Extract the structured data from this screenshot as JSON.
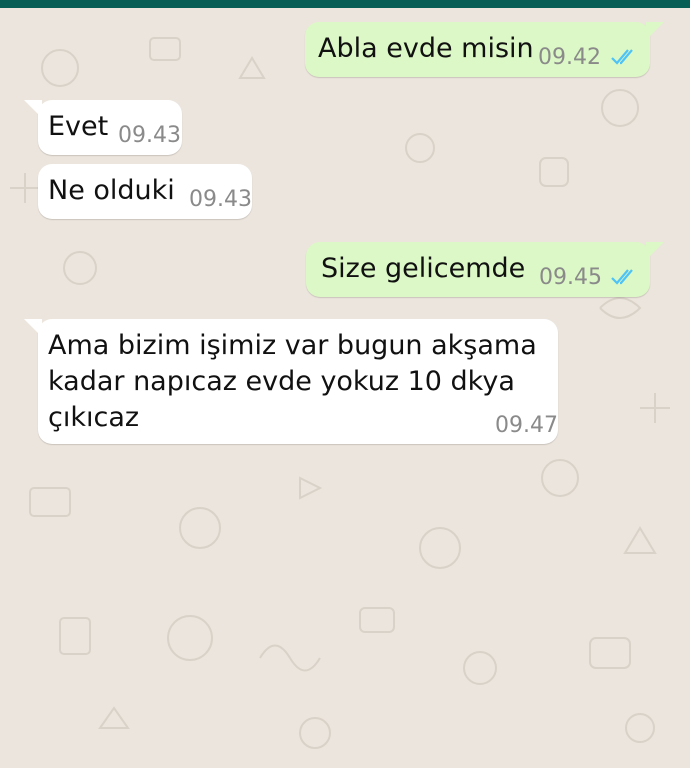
{
  "colors": {
    "header": "#075e54",
    "outgoing_bubble": "#dcf8c6",
    "incoming_bubble": "#ffffff",
    "read_ticks": "#4fc3f7",
    "wallpaper": "#ece5dd"
  },
  "messages": [
    {
      "direction": "outgoing",
      "text": "Abla evde misin",
      "time": "09.42",
      "status_icon": "double-check-read-icon"
    },
    {
      "direction": "incoming",
      "text": "Evet",
      "time": "09.43"
    },
    {
      "direction": "incoming",
      "text": "Ne olduki",
      "time": "09.43"
    },
    {
      "direction": "outgoing",
      "text": "Size gelicemde",
      "time": "09.45",
      "status_icon": "double-check-read-icon"
    },
    {
      "direction": "incoming",
      "text": "Ama bizim işimiz var bugun akşama\nkadar napıcaz evde yokuz 10 dkya\nçıkıcaz",
      "time": "09.47"
    }
  ]
}
